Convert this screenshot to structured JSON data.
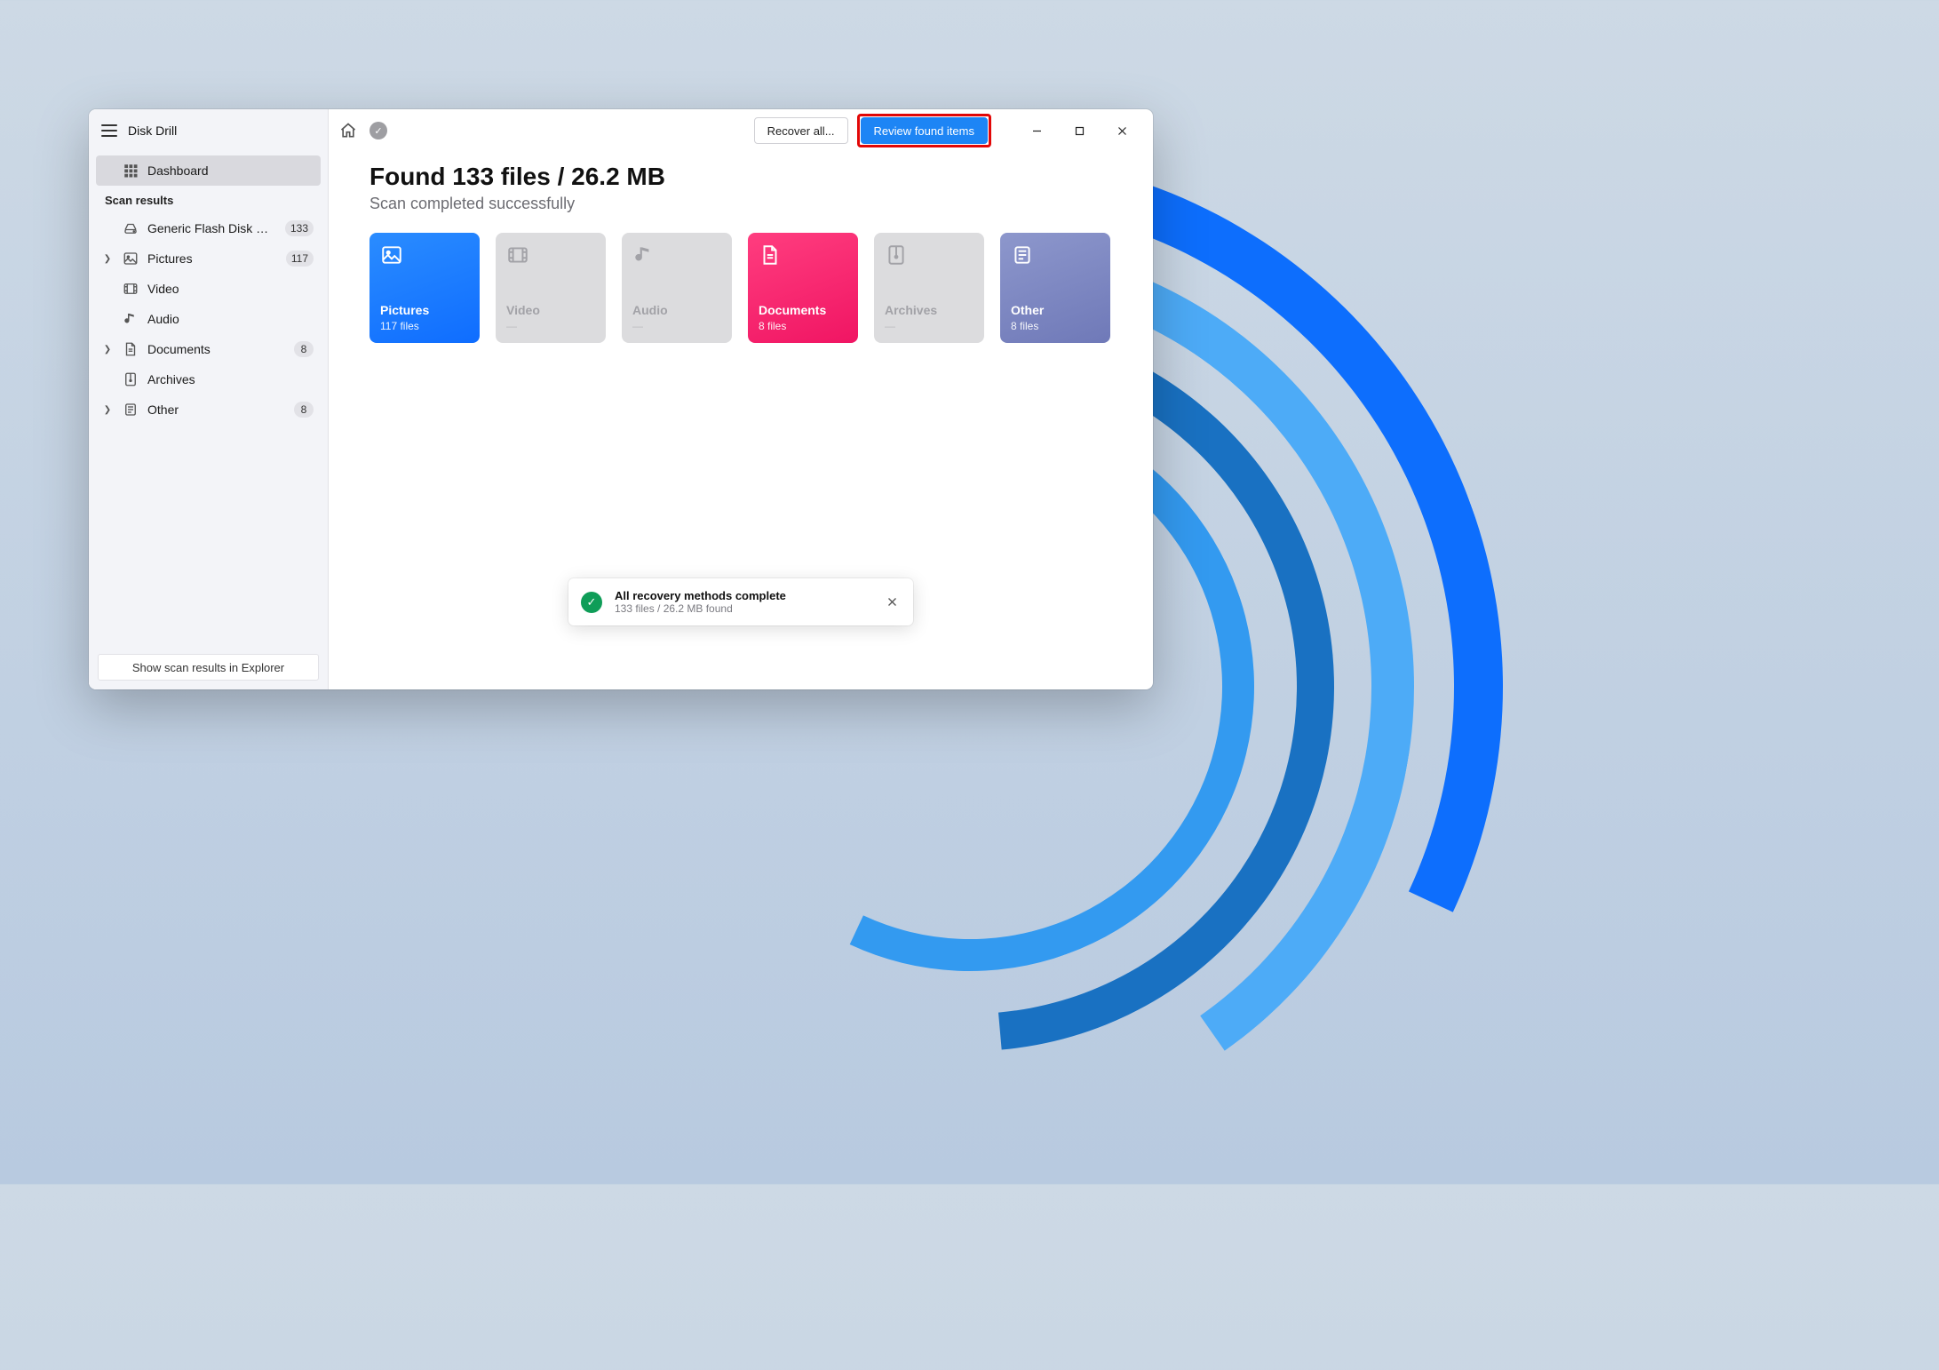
{
  "app_title": "Disk Drill",
  "sidebar": {
    "dashboard_label": "Dashboard",
    "scan_results_label": "Scan results",
    "items": [
      {
        "icon": "drive",
        "label": "Generic Flash Disk USB...",
        "badge": "133",
        "chev": false
      },
      {
        "icon": "picture",
        "label": "Pictures",
        "badge": "117",
        "chev": true
      },
      {
        "icon": "video",
        "label": "Video",
        "badge": "",
        "chev": false
      },
      {
        "icon": "audio",
        "label": "Audio",
        "badge": "",
        "chev": false
      },
      {
        "icon": "document",
        "label": "Documents",
        "badge": "8",
        "chev": true
      },
      {
        "icon": "archive",
        "label": "Archives",
        "badge": "",
        "chev": false
      },
      {
        "icon": "other",
        "label": "Other",
        "badge": "8",
        "chev": true
      }
    ],
    "footer_button": "Show scan results in Explorer"
  },
  "topbar": {
    "recover_label": "Recover all...",
    "review_label": "Review found items"
  },
  "headline": "Found 133 files / 26.2 MB",
  "subhead": "Scan completed successfully",
  "cards": [
    {
      "key": "pictures",
      "title": "Pictures",
      "sub": "117 files",
      "bg": "linear-gradient(160deg,#2a8cff 0%,#0f6dff 100%)",
      "enabled": true,
      "icon": "picture"
    },
    {
      "key": "video",
      "title": "Video",
      "sub": "—",
      "bg": "",
      "enabled": false,
      "icon": "video"
    },
    {
      "key": "audio",
      "title": "Audio",
      "sub": "—",
      "bg": "",
      "enabled": false,
      "icon": "audio"
    },
    {
      "key": "documents",
      "title": "Documents",
      "sub": "8 files",
      "bg": "linear-gradient(160deg,#ff3d7f 0%,#f01563 100%)",
      "enabled": true,
      "icon": "document"
    },
    {
      "key": "archives",
      "title": "Archives",
      "sub": "—",
      "bg": "",
      "enabled": false,
      "icon": "archive"
    },
    {
      "key": "other",
      "title": "Other",
      "sub": "8 files",
      "bg": "linear-gradient(160deg,#8d97cc 0%,#6f79b8 100%)",
      "enabled": true,
      "icon": "other"
    }
  ],
  "toast": {
    "title": "All recovery methods complete",
    "sub": "133 files / 26.2 MB found"
  }
}
